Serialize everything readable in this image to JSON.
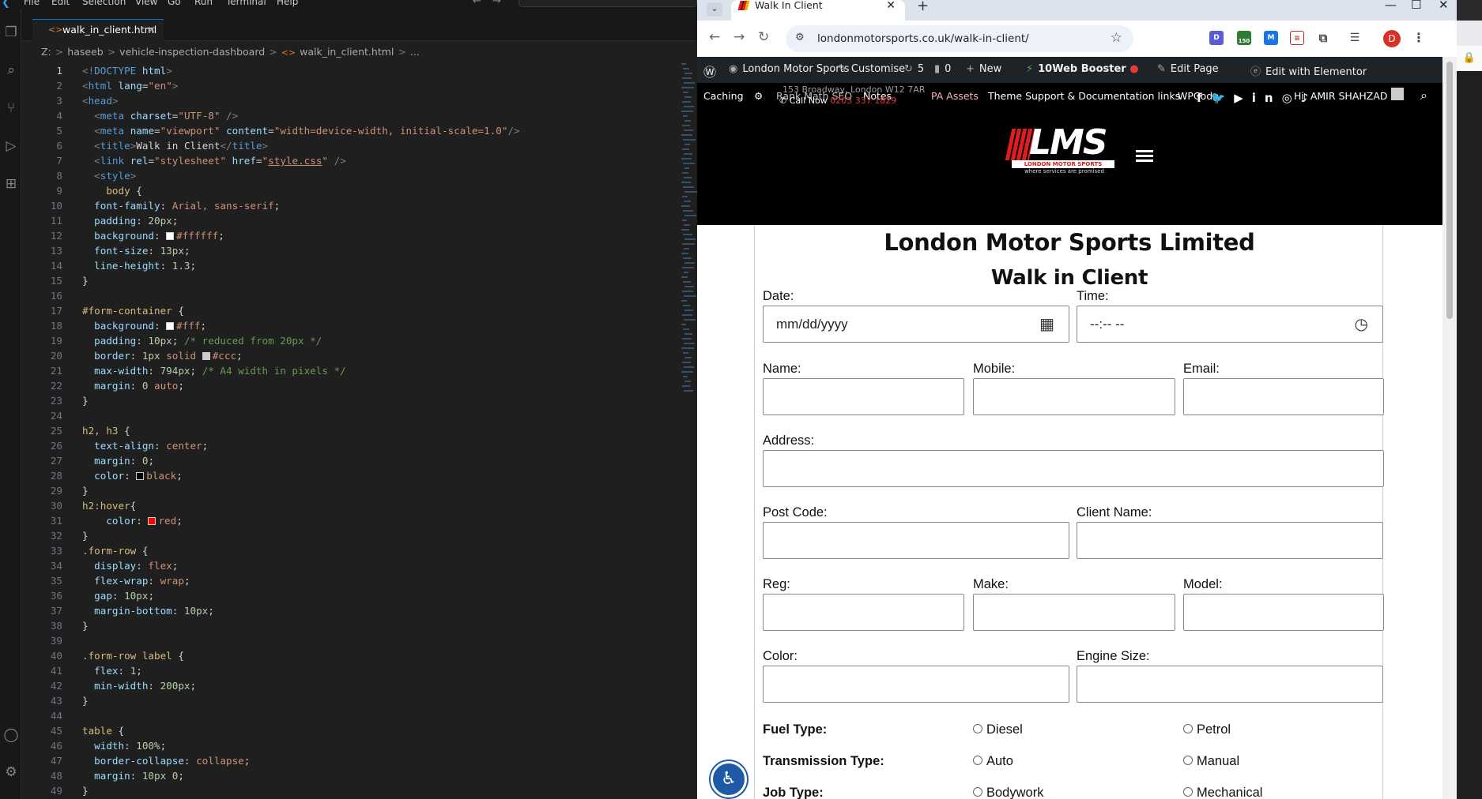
{
  "vscode": {
    "menu": [
      "File",
      "Edit",
      "Selection",
      "View",
      "Go",
      "Run",
      "Terminal",
      "Help"
    ],
    "tab_label": "walk_in_client.html",
    "breadcrumb": [
      "Z:",
      "haseeb",
      "vehicle-inspection-dashboard",
      "walk_in_client.html",
      "..."
    ],
    "code_lines": [
      {
        "n": "1",
        "html": "<span class='t-p'>&lt;!</span><span class='t-t'>DOCTYPE</span> <span class='t-a'>html</span><span class='t-p'>&gt;</span>"
      },
      {
        "n": "2",
        "html": "<span class='t-p'>&lt;</span><span class='t-t'>html</span> <span class='t-a'>lang</span><span class='t-x'>=</span><span class='t-s'>\"en\"</span><span class='t-p'>&gt;</span>"
      },
      {
        "n": "3",
        "html": "<span class='t-p'>&lt;</span><span class='t-t'>head</span><span class='t-p'>&gt;</span>"
      },
      {
        "n": "4",
        "html": "  <span class='t-p'>&lt;</span><span class='t-t'>meta</span> <span class='t-a'>charset</span><span class='t-x'>=</span><span class='t-s'>\"UTF-8\"</span> <span class='t-p'>/&gt;</span>"
      },
      {
        "n": "5",
        "html": "  <span class='t-p'>&lt;</span><span class='t-t'>meta</span> <span class='t-a'>name</span><span class='t-x'>=</span><span class='t-s'>\"viewport\"</span> <span class='t-a'>content</span><span class='t-x'>=</span><span class='t-s'>\"width=device-width, initial-scale=1.0\"</span><span class='t-p'>/&gt;</span>"
      },
      {
        "n": "6",
        "html": "  <span class='t-p'>&lt;</span><span class='t-t'>title</span><span class='t-p'>&gt;</span><span class='t-x'>Walk in Client</span><span class='t-p'>&lt;/</span><span class='t-t'>title</span><span class='t-p'>&gt;</span>"
      },
      {
        "n": "7",
        "html": "  <span class='t-p'>&lt;</span><span class='t-t'>link</span> <span class='t-a'>rel</span><span class='t-x'>=</span><span class='t-s'>\"stylesheet\"</span> <span class='t-a'>href</span><span class='t-x'>=</span><span class='t-s'>\"<span class='t-u'>style.css</span>\"</span> <span class='t-p'>/&gt;</span>"
      },
      {
        "n": "8",
        "html": "  <span class='t-p'>&lt;</span><span class='t-t'>style</span><span class='t-p'>&gt;</span>"
      },
      {
        "n": "9",
        "html": "    <span class='t-sel'>body</span> <span class='t-x'>{</span>"
      },
      {
        "n": "10",
        "html": "  <span class='t-a'>font-family</span><span class='t-x'>: </span><span class='t-s'>Arial, sans-serif</span><span class='t-x'>;</span>"
      },
      {
        "n": "11",
        "html": "  <span class='t-a'>padding</span><span class='t-x'>: </span><span class='t-n'>20px</span><span class='t-x'>;</span>"
      },
      {
        "n": "12",
        "html": "  <span class='t-a'>background</span><span class='t-x'>: </span><span class='sw' style='background:#ffffff'></span><span class='t-s'>#ffffff</span><span class='t-x'>;</span>"
      },
      {
        "n": "13",
        "html": "  <span class='t-a'>font-size</span><span class='t-x'>: </span><span class='t-n'>13px</span><span class='t-x'>;</span>"
      },
      {
        "n": "14",
        "html": "  <span class='t-a'>line-height</span><span class='t-x'>: </span><span class='t-n'>1.3</span><span class='t-x'>;</span>"
      },
      {
        "n": "15",
        "html": "<span class='t-x'>}</span>"
      },
      {
        "n": "16",
        "html": ""
      },
      {
        "n": "17",
        "html": "<span class='t-sel'>#form-container</span> <span class='t-x'>{</span>"
      },
      {
        "n": "18",
        "html": "  <span class='t-a'>background</span><span class='t-x'>: </span><span class='sw' style='background:#fff'></span><span class='t-s'>#fff</span><span class='t-x'>;</span>"
      },
      {
        "n": "19",
        "html": "  <span class='t-a'>padding</span><span class='t-x'>: </span><span class='t-n'>10px</span><span class='t-x'>; </span><span class='t-c'>/* reduced from 20px */</span>"
      },
      {
        "n": "20",
        "html": "  <span class='t-a'>border</span><span class='t-x'>: </span><span class='t-n'>1px</span> <span class='t-s'>solid</span> <span class='sw' style='background:#ccc'></span><span class='t-s'>#ccc</span><span class='t-x'>;</span>"
      },
      {
        "n": "21",
        "html": "  <span class='t-a'>max-width</span><span class='t-x'>: </span><span class='t-n'>794px</span><span class='t-x'>; </span><span class='t-c'>/* A4 width in pixels */</span>"
      },
      {
        "n": "22",
        "html": "  <span class='t-a'>margin</span><span class='t-x'>: </span><span class='t-n'>0</span> <span class='t-s'>auto</span><span class='t-x'>;</span>"
      },
      {
        "n": "23",
        "html": "<span class='t-x'>}</span>"
      },
      {
        "n": "24",
        "html": ""
      },
      {
        "n": "25",
        "html": "<span class='t-sel'>h2, h3</span> <span class='t-x'>{</span>"
      },
      {
        "n": "26",
        "html": "  <span class='t-a'>text-align</span><span class='t-x'>: </span><span class='t-s'>center</span><span class='t-x'>;</span>"
      },
      {
        "n": "27",
        "html": "  <span class='t-a'>margin</span><span class='t-x'>: </span><span class='t-n'>0</span><span class='t-x'>;</span>"
      },
      {
        "n": "28",
        "html": "  <span class='t-a'>color</span><span class='t-x'>: </span><span class='sw' style='background:#000'></span><span class='t-s'>black</span><span class='t-x'>;</span>"
      },
      {
        "n": "29",
        "html": "<span class='t-x'>}</span>"
      },
      {
        "n": "30",
        "html": "<span class='t-sel'>h2:hover</span><span class='t-x'>{</span>"
      },
      {
        "n": "31",
        "html": "    <span class='t-a'>color</span><span class='t-x'>: </span><span class='sw' style='background:#f00'></span><span class='t-s'>red</span><span class='t-x'>;</span>"
      },
      {
        "n": "32",
        "html": "<span class='t-x'>}</span>"
      },
      {
        "n": "33",
        "html": "<span class='t-sel'>.form-row</span> <span class='t-x'>{</span>"
      },
      {
        "n": "34",
        "html": "  <span class='t-a'>display</span><span class='t-x'>: </span><span class='t-s'>flex</span><span class='t-x'>;</span>"
      },
      {
        "n": "35",
        "html": "  <span class='t-a'>flex-wrap</span><span class='t-x'>: </span><span class='t-s'>wrap</span><span class='t-x'>;</span>"
      },
      {
        "n": "36",
        "html": "  <span class='t-a'>gap</span><span class='t-x'>: </span><span class='t-n'>10px</span><span class='t-x'>;</span>"
      },
      {
        "n": "37",
        "html": "  <span class='t-a'>margin-bottom</span><span class='t-x'>: </span><span class='t-n'>10px</span><span class='t-x'>;</span>"
      },
      {
        "n": "38",
        "html": "<span class='t-x'>}</span>"
      },
      {
        "n": "39",
        "html": ""
      },
      {
        "n": "40",
        "html": "<span class='t-sel'>.form-row label</span> <span class='t-x'>{</span>"
      },
      {
        "n": "41",
        "html": "  <span class='t-a'>flex</span><span class='t-x'>: </span><span class='t-n'>1</span><span class='t-x'>;</span>"
      },
      {
        "n": "42",
        "html": "  <span class='t-a'>min-width</span><span class='t-x'>: </span><span class='t-n'>200px</span><span class='t-x'>;</span>"
      },
      {
        "n": "43",
        "html": "<span class='t-x'>}</span>"
      },
      {
        "n": "44",
        "html": ""
      },
      {
        "n": "45",
        "html": "<span class='t-sel'>table</span> <span class='t-x'>{</span>"
      },
      {
        "n": "46",
        "html": "  <span class='t-a'>width</span><span class='t-x'>: </span><span class='t-n'>100%</span><span class='t-x'>;</span>"
      },
      {
        "n": "47",
        "html": "  <span class='t-a'>border-collapse</span><span class='t-x'>: </span><span class='t-s'>collapse</span><span class='t-x'>;</span>"
      },
      {
        "n": "48",
        "html": "  <span class='t-a'>margin</span><span class='t-x'>: </span><span class='t-n'>10px</span> <span class='t-n'>0</span><span class='t-x'>;</span>"
      },
      {
        "n": "49",
        "html": "<span class='t-x'>}</span>"
      }
    ]
  },
  "browser": {
    "tab_title": "Walk In Client",
    "url": "londonmotorsports.co.uk/walk-in-client/",
    "profile_initial": "D",
    "ext_badge": "150",
    "wp_admin_bar": {
      "site_name": "London Motor Sports",
      "customise": "Customise",
      "updates": "5",
      "comments": "0",
      "new": "New",
      "booster": "10Web Booster",
      "edit_page": "Edit Page",
      "elementor": "Edit with Elementor",
      "caching": "Caching",
      "rank_math": "Rank Math SEO",
      "notes": "Notes",
      "pa_assets": "PA Assets",
      "theme_support": "Theme Support & Documentation links",
      "wpcode": "WPCode",
      "greeting": "Hi, AMIR SHAHZAD"
    },
    "site": {
      "address_snippet": "153 Broadway, London W12 7AR",
      "call_label": "Call Now",
      "phone": "0203 337 1829",
      "logo_text": "LMS",
      "logo_band": "LONDON MOTOR SPORTS",
      "logo_tagline": "where services are promised"
    },
    "form": {
      "title": "London Motor Sports Limited",
      "subtitle": "Walk in Client",
      "date_label": "Date:",
      "date_placeholder": "mm/dd/yyyy",
      "time_label": "Time:",
      "time_placeholder": "--:-- --",
      "name_label": "Name:",
      "mobile_label": "Mobile:",
      "email_label": "Email:",
      "address_label": "Address:",
      "postcode_label": "Post Code:",
      "client_name_label": "Client Name:",
      "reg_label": "Reg:",
      "make_label": "Make:",
      "model_label": "Model:",
      "color_label": "Color:",
      "engine_label": "Engine Size:",
      "fuel_label": "Fuel Type:",
      "fuel_options": [
        "Diesel",
        "Petrol"
      ],
      "transmission_label": "Transmission Type:",
      "transmission_options": [
        "Auto",
        "Manual"
      ],
      "job_label": "Job Type:",
      "job_options": [
        "Bodywork",
        "Mechanical"
      ]
    }
  }
}
